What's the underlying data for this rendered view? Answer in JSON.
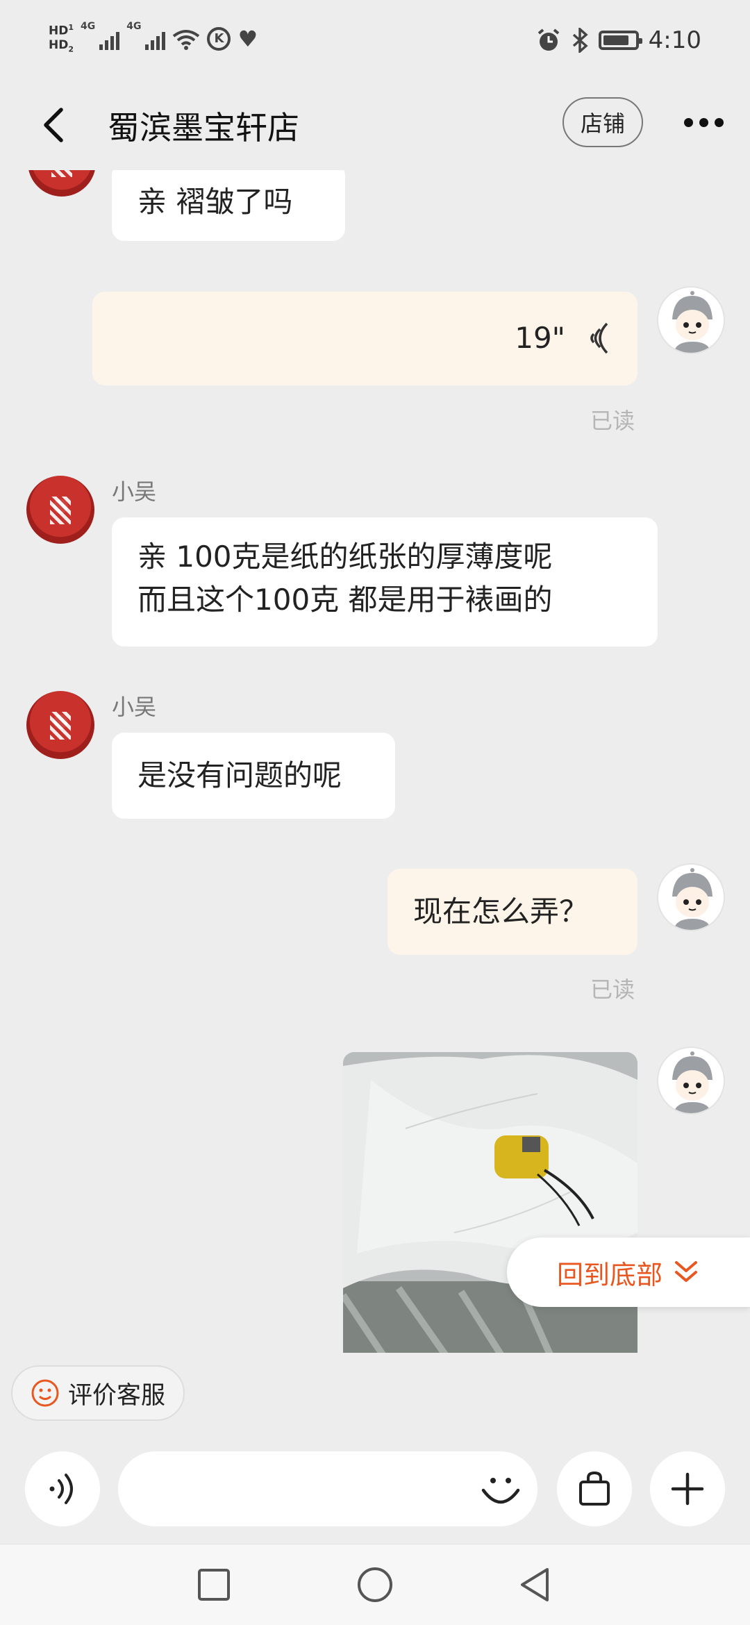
{
  "status_bar": {
    "left": {
      "hd1": "HD",
      "hd1_sub": "1",
      "hd2": "HD",
      "hd2_sub": "2",
      "net1": "4G",
      "net2": "4G"
    },
    "time": "4:10"
  },
  "header": {
    "title": "蜀滨墨宝轩店",
    "shop_button": "店铺",
    "icons": [
      "back-arrow-icon",
      "more-icon"
    ]
  },
  "messages": [
    {
      "sender": "shop",
      "text": "亲  褶皱了吗"
    },
    {
      "sender": "me",
      "type": "voice",
      "duration": "19\"",
      "status": "已读"
    },
    {
      "sender": "shop",
      "name": "小吴",
      "lines": [
        "亲   100克是纸的纸张的厚薄度呢",
        "而且这个100克 都是用于裱画的"
      ]
    },
    {
      "sender": "shop",
      "name": "小吴",
      "text": "是没有问题的呢"
    },
    {
      "sender": "me",
      "text": "现在怎么弄？",
      "status": "已读"
    },
    {
      "sender": "me",
      "type": "image",
      "image_desc": "photo"
    }
  ],
  "scroll_to_bottom": "回到底部",
  "rate_button": "评价客服",
  "input": {
    "placeholder": ""
  },
  "colors": {
    "accent": "#e8571f",
    "my_bubble": "#fdf5ea",
    "background": "#ededed"
  }
}
